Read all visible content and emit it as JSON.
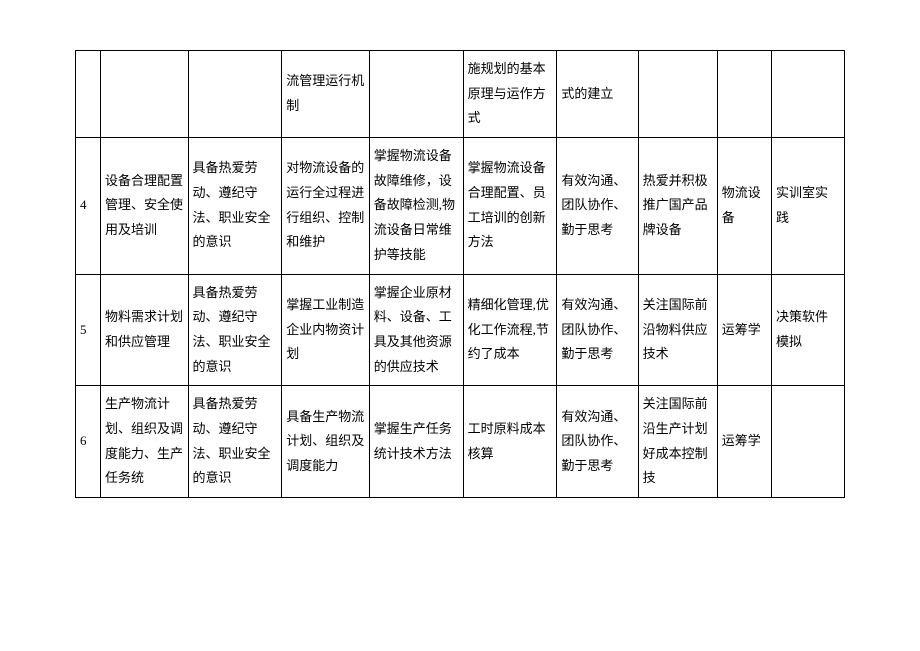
{
  "rows": [
    {
      "num": "",
      "c2": "",
      "c3": "",
      "c4": "流管理运行机制",
      "c5": "",
      "c6": "施规划的基本原理与运作方式",
      "c7": "式的建立",
      "c8": "",
      "c9": "",
      "c10": ""
    },
    {
      "num": "4",
      "c2": "设备合理配置管理、安全使用及培训",
      "c3": "具备热爱劳动、遵纪守法、职业安全的意识",
      "c4": "对物流设备的运行全过程进行组织、控制和维护",
      "c5": "掌握物流设备故障维修，设备故障检测,物流设备日常维护等技能",
      "c6": "掌握物流设备合理配置、员工培训的创新方法",
      "c7": "有效沟通、团队协作、勤于思考",
      "c8": "热爱并积极推广国产品牌设备",
      "c9": "物流设备",
      "c10": "实训室实践"
    },
    {
      "num": "5",
      "c2": "物料需求计划和供应管理",
      "c3": "具备热爱劳动、遵纪守法、职业安全的意识",
      "c4": "掌握工业制造企业内物资计划",
      "c5": "掌握企业原材料、设备、工具及其他资源的供应技术",
      "c6": "精细化管理,优化工作流程,节约了成本",
      "c7": "有效沟通、团队协作、勤于思考",
      "c8": "关注国际前沿物料供应技术",
      "c9": "运筹学",
      "c10": "决策软件模拟"
    },
    {
      "num": "6",
      "c2": "生产物流计划、组织及调度能力、生产任务统",
      "c3": "具备热爱劳动、遵纪守法、职业安全的意识",
      "c4": "具备生产物流计划、组织及调度能力",
      "c5": "掌握生产任务统计技术方法",
      "c6": "工时原料成本核算",
      "c7": "有效沟通、团队协作、勤于思考",
      "c8": "关注国际前沿生产计划好成本控制技",
      "c9": "运筹学",
      "c10": ""
    }
  ]
}
